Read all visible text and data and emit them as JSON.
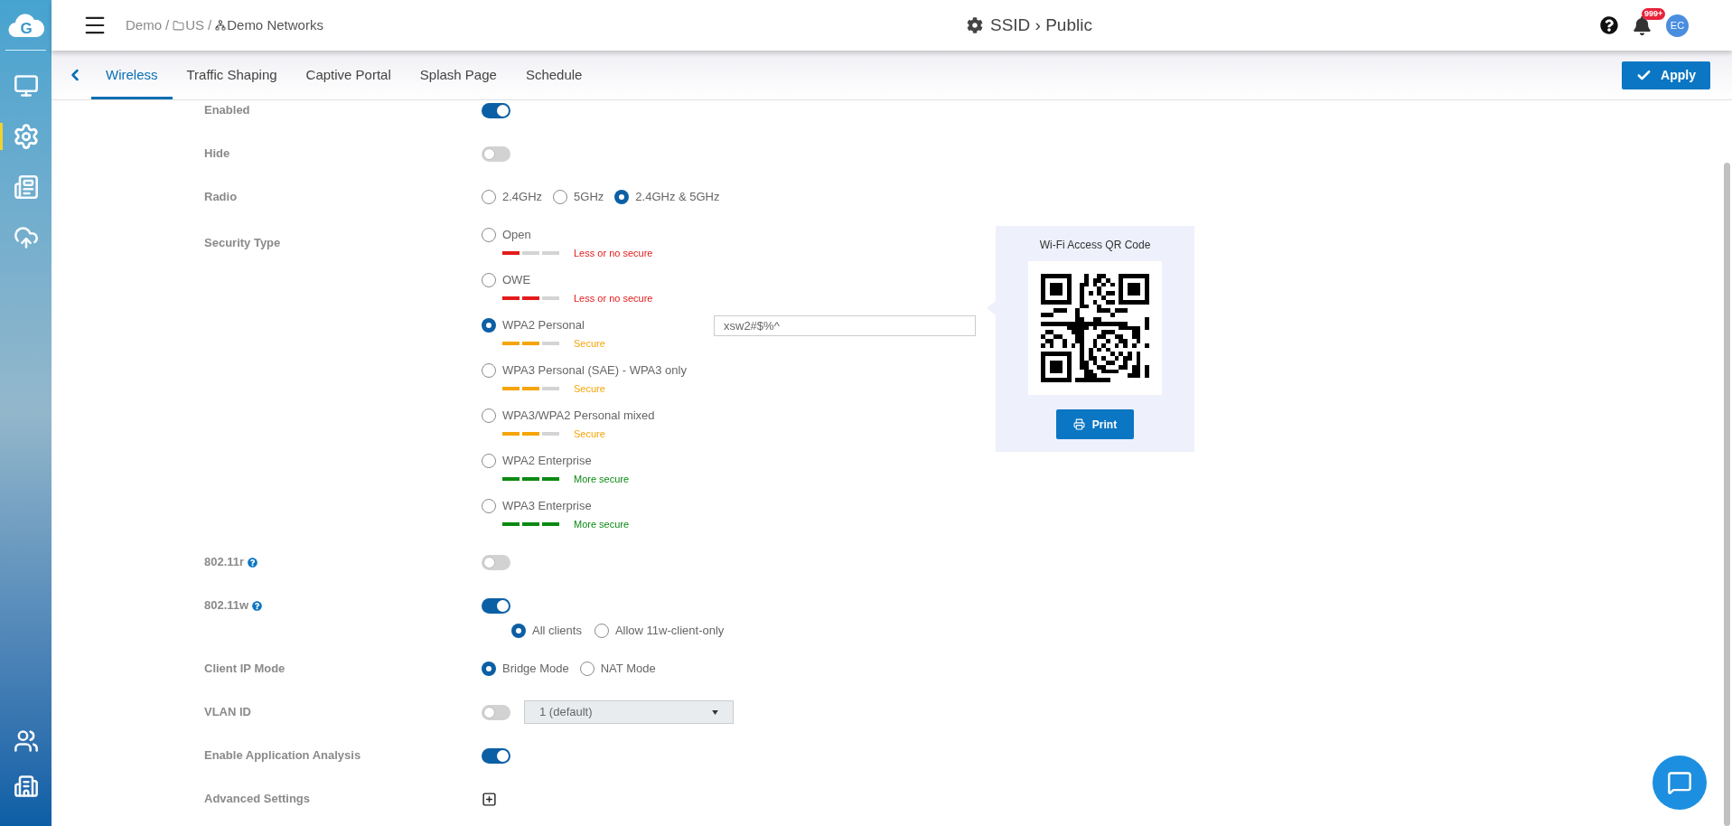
{
  "sidebar": {
    "logo": "G",
    "top_items": [
      {
        "kind": "monitor",
        "selected": false
      },
      {
        "kind": "settings",
        "selected": true
      },
      {
        "kind": "report",
        "selected": false
      },
      {
        "kind": "cloud",
        "selected": false
      }
    ],
    "bottom_items": [
      {
        "kind": "users",
        "selected": false
      },
      {
        "kind": "building",
        "selected": false
      }
    ]
  },
  "header": {
    "breadcrumb": [
      {
        "label": "Demo",
        "kind": "plain"
      },
      {
        "label": "US",
        "kind": "folder"
      },
      {
        "label": "Demo Networks",
        "kind": "network"
      }
    ],
    "separator": "/",
    "title": "SSID › Public",
    "notification_count": "999+",
    "avatar": "EC"
  },
  "tabs": [
    {
      "label": "Wireless",
      "selected": true
    },
    {
      "label": "Traffic Shaping",
      "selected": false
    },
    {
      "label": "Captive Portal",
      "selected": false
    },
    {
      "label": "Splash Page",
      "selected": false
    },
    {
      "label": "Schedule",
      "selected": false
    }
  ],
  "apply_button": "Apply",
  "form": {
    "rows": [
      {
        "kind": "toggle",
        "label": "Enabled",
        "help": false,
        "on": true
      },
      {
        "kind": "toggle",
        "label": "Hide",
        "help": false,
        "on": false
      },
      {
        "kind": "radio",
        "label": "Radio",
        "help": false,
        "options": [
          {
            "label": "2.4GHz",
            "selected": false
          },
          {
            "label": "5GHz",
            "selected": false
          },
          {
            "label": "2.4GHz & 5GHz",
            "selected": true
          }
        ]
      },
      {
        "kind": "security",
        "label": "Security Type",
        "help": false,
        "password": "xsw2#$%^",
        "options": [
          {
            "label": "Open",
            "selected": false,
            "level": 0.33,
            "color": "#e31b1b",
            "rating": "Less or no secure"
          },
          {
            "label": "OWE",
            "selected": false,
            "level": 0.67,
            "color": "#e31b1b",
            "rating": "Less or no secure"
          },
          {
            "label": "WPA2 Personal",
            "selected": true,
            "level": 0.67,
            "color": "#f5a509",
            "rating": "Secure"
          },
          {
            "label": "WPA3 Personal (SAE) - WPA3 only",
            "selected": false,
            "level": 0.67,
            "color": "#f5a509",
            "rating": "Secure"
          },
          {
            "label": "WPA3/WPA2 Personal mixed",
            "selected": false,
            "level": 0.67,
            "color": "#f5a509",
            "rating": "Secure"
          },
          {
            "label": "WPA2 Enterprise",
            "selected": false,
            "level": 1,
            "color": "#0b8a12",
            "rating": "More secure"
          },
          {
            "label": "WPA3 Enterprise",
            "selected": false,
            "level": 1,
            "color": "#0b8a12",
            "rating": "More secure"
          }
        ]
      },
      {
        "kind": "toggle",
        "label": "802.11r",
        "help": true,
        "on": false
      },
      {
        "kind": "toggle",
        "label": "802.11w",
        "help": true,
        "on": true,
        "options": [
          {
            "label": "All clients",
            "selected": true
          },
          {
            "label": "Allow 11w-client-only",
            "selected": false
          }
        ]
      },
      {
        "kind": "radio",
        "label": "Client IP Mode",
        "help": false,
        "options": [
          {
            "label": "Bridge Mode",
            "selected": true
          },
          {
            "label": "NAT Mode",
            "selected": false
          }
        ]
      },
      {
        "kind": "select",
        "label": "VLAN ID",
        "help": false,
        "on": false,
        "value": "1 (default)"
      },
      {
        "kind": "toggle",
        "label": "Enable Application Analysis",
        "help": false,
        "on": true
      },
      {
        "kind": "expand",
        "label": "Advanced Settings",
        "help": false,
        "expanded": false
      }
    ]
  },
  "qr_panel": {
    "title": "Wi-Fi Access QR Code",
    "print_button": "Print"
  }
}
